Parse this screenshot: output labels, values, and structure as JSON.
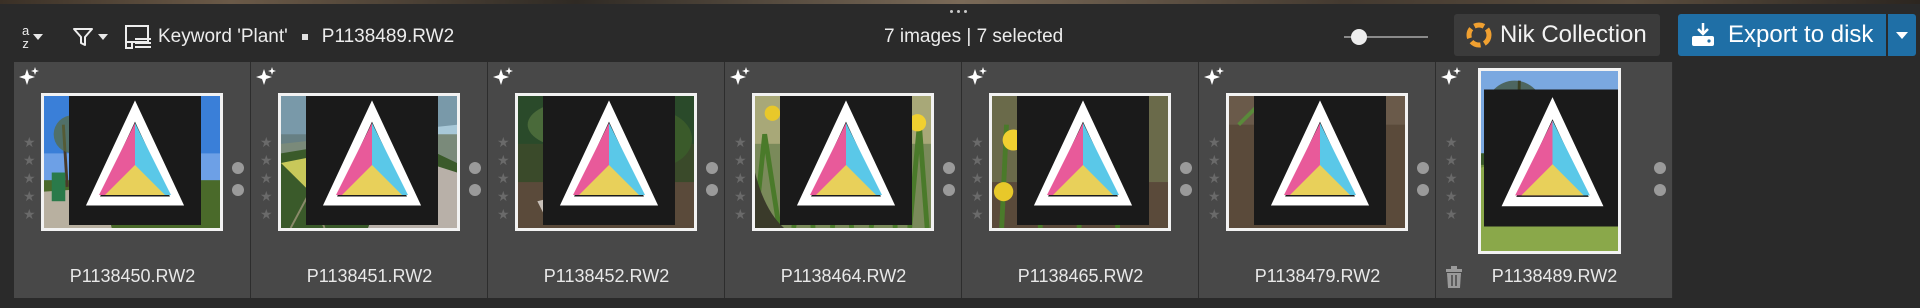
{
  "toolbar": {
    "sort_top": "a",
    "sort_bottom": "z",
    "keyword_label": "Keyword 'Plant'",
    "current_file": "P1138489.RW2",
    "image_count": "7 images | 7 selected",
    "zoom_fraction": 0.18,
    "nik_label": "Nik Collection",
    "export_label": "Export to disk"
  },
  "filmstrip": [
    {
      "filename": "P1138450.RW2",
      "stars": 0,
      "selected": true,
      "scene": "park"
    },
    {
      "filename": "P1138451.RW2",
      "stars": 0,
      "selected": true,
      "scene": "greenhouse"
    },
    {
      "filename": "P1138452.RW2",
      "stars": 0,
      "selected": true,
      "scene": "primrose"
    },
    {
      "filename": "P1138464.RW2",
      "stars": 0,
      "selected": true,
      "scene": "daffodils"
    },
    {
      "filename": "P1138465.RW2",
      "stars": 0,
      "selected": true,
      "scene": "daffodils2"
    },
    {
      "filename": "P1138479.RW2",
      "stars": 0,
      "selected": true,
      "scene": "bluebells"
    },
    {
      "filename": "P1138489.RW2",
      "stars": 0,
      "selected": true,
      "scene": "garden-portrait"
    }
  ],
  "colors": {
    "accent": "#1f6fa6",
    "background": "#2a2a2a",
    "cell": "#484848"
  },
  "icons": [
    "sort-az-icon",
    "filter-icon",
    "keyword-icon",
    "nik-logo-icon",
    "export-icon",
    "sparkle-icon",
    "color-profile-icon",
    "trash-icon",
    "star-icon"
  ]
}
